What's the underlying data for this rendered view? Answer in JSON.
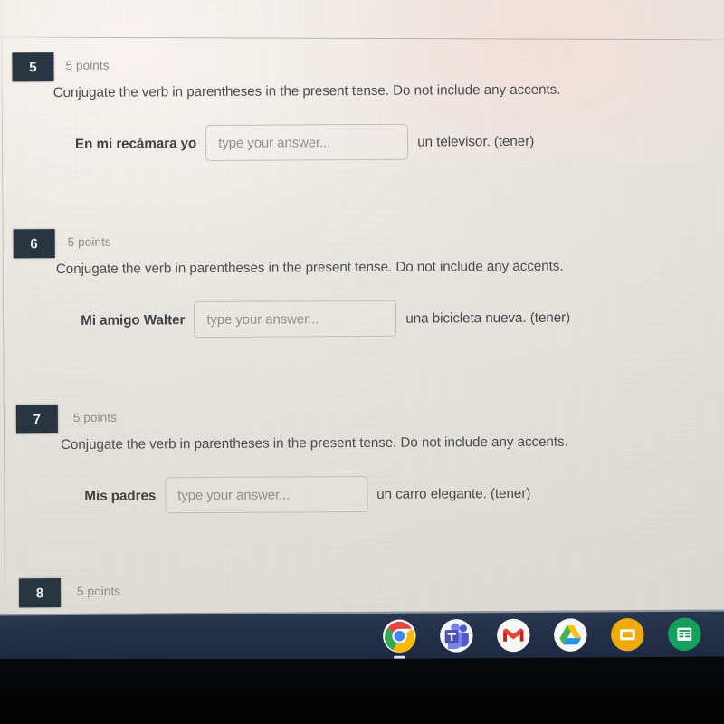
{
  "app": {
    "platform": "chromebook-shelf",
    "surface": "online-quiz-page"
  },
  "colors": {
    "page_background": "#e9e7e0",
    "badge_background": "#26323f",
    "badge_text": "#f2f1ec",
    "points_text": "#8d8b85",
    "prompt_text": "#4a4c4e",
    "input_border": "#c3c1b9",
    "placeholder_text": "#93918b",
    "shelf_background": "#24314a"
  },
  "questions": [
    {
      "number": "5",
      "points": "5 points",
      "prompt": "Conjugate the verb in parentheses in the present tense. Do not include any accents.",
      "sentence_before": "En mi recámara yo",
      "input_placeholder": "type your answer...",
      "input_value": "",
      "sentence_after": "un televisor. (tener)"
    },
    {
      "number": "6",
      "points": "5 points",
      "prompt": "Conjugate the verb in parentheses in the present tense. Do not include any accents.",
      "sentence_before": "Mi amigo Walter",
      "input_placeholder": "type your answer...",
      "input_value": "",
      "sentence_after": "una bicicleta nueva. (tener)"
    },
    {
      "number": "7",
      "points": "5 points",
      "prompt": "Conjugate the verb in parentheses in the present tense. Do not include any accents.",
      "sentence_before": "Mis padres",
      "input_placeholder": "type your answer...",
      "input_value": "",
      "sentence_after": "un carro elegante. (tener)"
    },
    {
      "number": "8",
      "points": "5 points",
      "prompt": "",
      "sentence_before": "",
      "input_placeholder": "",
      "input_value": "",
      "sentence_after": ""
    }
  ],
  "shelf": {
    "icons": [
      {
        "name": "chrome-icon",
        "label": "Google Chrome",
        "running": true
      },
      {
        "name": "microsoft-teams-icon",
        "label": "Microsoft Teams",
        "running": false
      },
      {
        "name": "gmail-icon",
        "label": "Gmail",
        "running": false
      },
      {
        "name": "google-drive-icon",
        "label": "Google Drive",
        "running": false
      },
      {
        "name": "google-slides-icon",
        "label": "Google Slides",
        "running": false
      },
      {
        "name": "google-sheets-icon",
        "label": "Google Sheets",
        "running": false
      }
    ]
  }
}
